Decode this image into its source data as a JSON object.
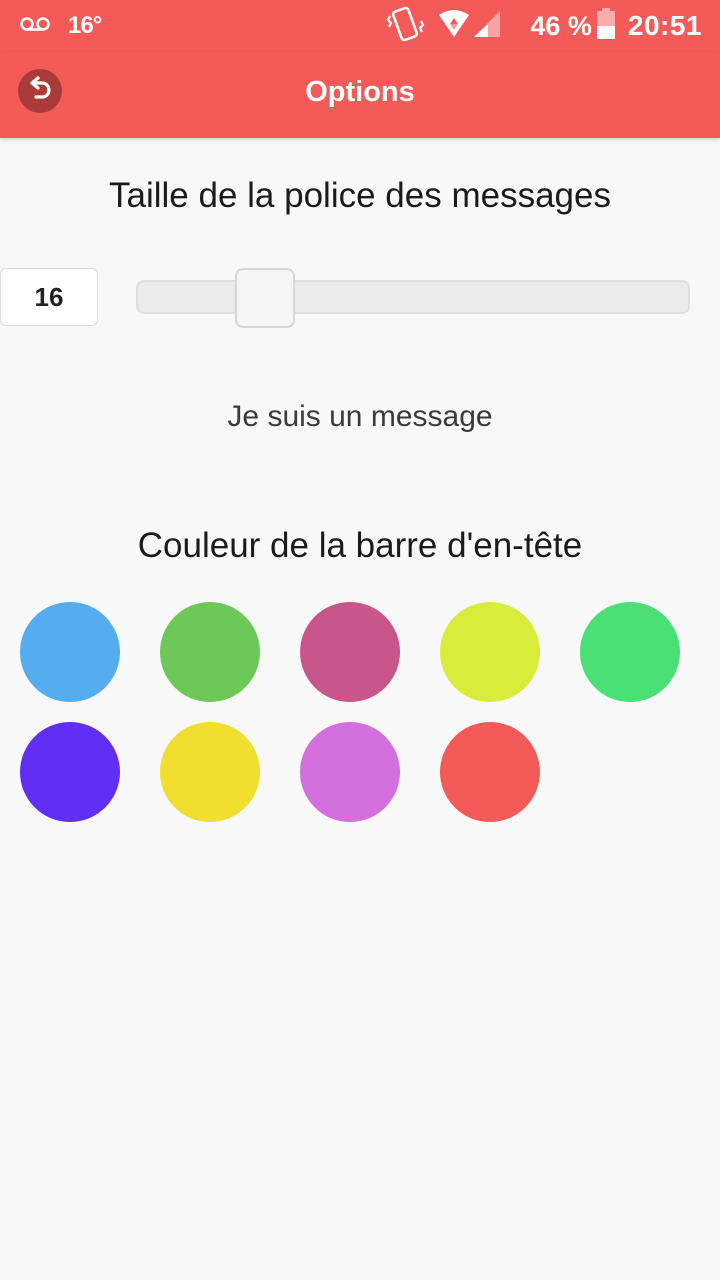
{
  "status_bar": {
    "voicemail_icon": "voicemail-icon",
    "temperature": "16°",
    "battery_percent": "46 %",
    "time": "20:51"
  },
  "app_bar": {
    "title": "Options",
    "back_icon": "undo-arrow-icon"
  },
  "font_size": {
    "section_title": "Taille de la police des messages",
    "value": "16",
    "slider_level": 0.2,
    "sample_text": "Je suis un message"
  },
  "header_color": {
    "section_title": "Couleur de la barre d'en-tête",
    "colors": [
      "#55acee",
      "#6cc957",
      "#c9568a",
      "#d9ec3a",
      "#4ae076",
      "#612ef5",
      "#f2de2e",
      "#d46fde",
      "#f45a58"
    ]
  }
}
